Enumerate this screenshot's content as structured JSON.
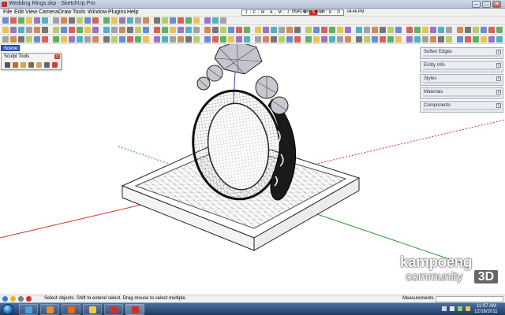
{
  "window": {
    "title": "Wedding Rings.skp - SketchUp Pro",
    "controls": [
      "–",
      "□",
      "✕"
    ]
  },
  "menu": {
    "items": [
      "File",
      "Edit",
      "View",
      "Camera",
      "Draw",
      "Tools",
      "Window",
      "Plugins",
      "Help"
    ]
  },
  "shadow_settings": {
    "months": [
      "J",
      "F",
      "M",
      "A",
      "M",
      "J",
      "J",
      "A",
      "S",
      "O",
      "N",
      "D"
    ],
    "highlighted_month_index": 8,
    "time_start": "06:43 AM",
    "time_noon": "Noon",
    "time_end": "04:46 PM"
  },
  "scene_tab": {
    "label": "Scene 1"
  },
  "sculpt_tools": {
    "title": "Sculpt Tools",
    "close": "x",
    "button_icons": [
      "select-icon",
      "sculpt-brush-icon",
      "smooth-icon",
      "flatten-icon",
      "soften-icon",
      "undo-icon",
      "delete-icon"
    ]
  },
  "trays": [
    {
      "title": "Soften Edges",
      "button": "x"
    },
    {
      "title": "Entity Info",
      "button": "x"
    },
    {
      "title": "Styles",
      "button": "x"
    },
    {
      "title": "Materials",
      "button": "x"
    },
    {
      "title": "Components",
      "button": "x"
    }
  ],
  "statusbar": {
    "message": "Select objects. Shift to extend select. Drag mouse to select multiple.",
    "measurements_label": "Measurements",
    "measurements_value": ""
  },
  "logo": {
    "word": "kampoeng",
    "community": "community",
    "mark": "3D"
  },
  "taskbar": {
    "apps": [
      "explorer-icon",
      "media-player-icon",
      "firefox-icon",
      "folder-icon",
      "opera-icon",
      "sketchup-icon"
    ],
    "active_app_index": 5,
    "time": "11:07 AM",
    "date": "12/16/2011"
  },
  "colors": {
    "axis_red": "#d0312d",
    "axis_green": "#2e9e33",
    "axis_blue": "#3b3bd6",
    "box_face": "#ffffff",
    "gem_fill": "#bfc0c7",
    "taskbar": "#1f3b63"
  }
}
